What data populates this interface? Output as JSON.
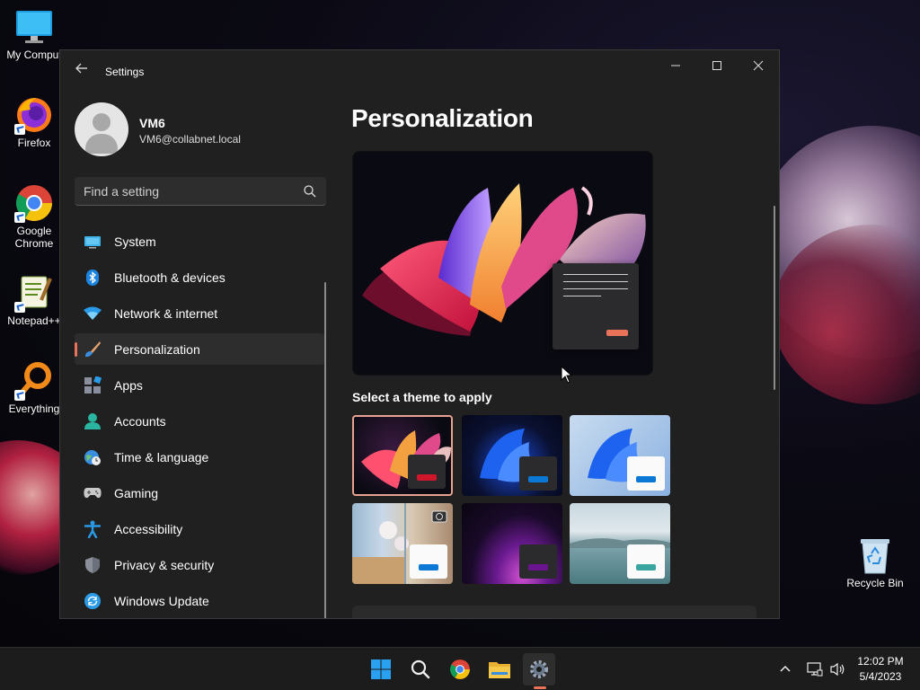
{
  "desktop": {
    "icons": [
      {
        "label": "My Comput"
      },
      {
        "label": "Firefox"
      },
      {
        "label": "Google Chrome"
      },
      {
        "label": "Notepad++"
      },
      {
        "label": "Everything"
      },
      {
        "label": "Recycle Bin"
      }
    ]
  },
  "window": {
    "title": "Settings",
    "back_icon": "back-arrow-icon",
    "controls": [
      "minimize",
      "maximize",
      "close"
    ]
  },
  "user": {
    "name": "VM6",
    "email": "VM6@collabnet.local"
  },
  "search": {
    "placeholder": "Find a setting"
  },
  "nav": {
    "items": [
      {
        "label": "System",
        "icon": "system-icon"
      },
      {
        "label": "Bluetooth & devices",
        "icon": "bluetooth-icon"
      },
      {
        "label": "Network & internet",
        "icon": "wifi-icon"
      },
      {
        "label": "Personalization",
        "icon": "brush-icon",
        "active": true
      },
      {
        "label": "Apps",
        "icon": "apps-icon"
      },
      {
        "label": "Accounts",
        "icon": "accounts-icon"
      },
      {
        "label": "Time & language",
        "icon": "globe-clock-icon"
      },
      {
        "label": "Gaming",
        "icon": "gamepad-icon"
      },
      {
        "label": "Accessibility",
        "icon": "accessibility-icon"
      },
      {
        "label": "Privacy & security",
        "icon": "shield-icon"
      },
      {
        "label": "Windows Update",
        "icon": "update-icon"
      }
    ]
  },
  "content": {
    "title": "Personalization",
    "themes_heading": "Select a theme to apply",
    "themes": [
      {
        "name": "bloom-glow",
        "selected": true,
        "accent": "#d0162a"
      },
      {
        "name": "windows-dark",
        "selected": false,
        "accent": "#0a78d4"
      },
      {
        "name": "windows-light",
        "selected": false,
        "accent": "#0a78d4"
      },
      {
        "name": "captured-motion",
        "selected": false,
        "accent": "#0a78d4"
      },
      {
        "name": "glow",
        "selected": false,
        "accent": "#6b1490"
      },
      {
        "name": "sunrise",
        "selected": false,
        "accent": "#3aa5a0"
      }
    ]
  },
  "taskbar": {
    "apps": [
      "start-icon",
      "search-icon",
      "chrome-icon",
      "file-explorer-icon",
      "settings-icon"
    ],
    "tray": [
      "chevron-up-icon",
      "network-icon",
      "volume-icon"
    ],
    "time": "12:02 PM",
    "date": "5/4/2023"
  },
  "colors": {
    "accent": "#e8735a",
    "window_bg": "#202020",
    "taskbar_bg": "#1c1c1c"
  }
}
